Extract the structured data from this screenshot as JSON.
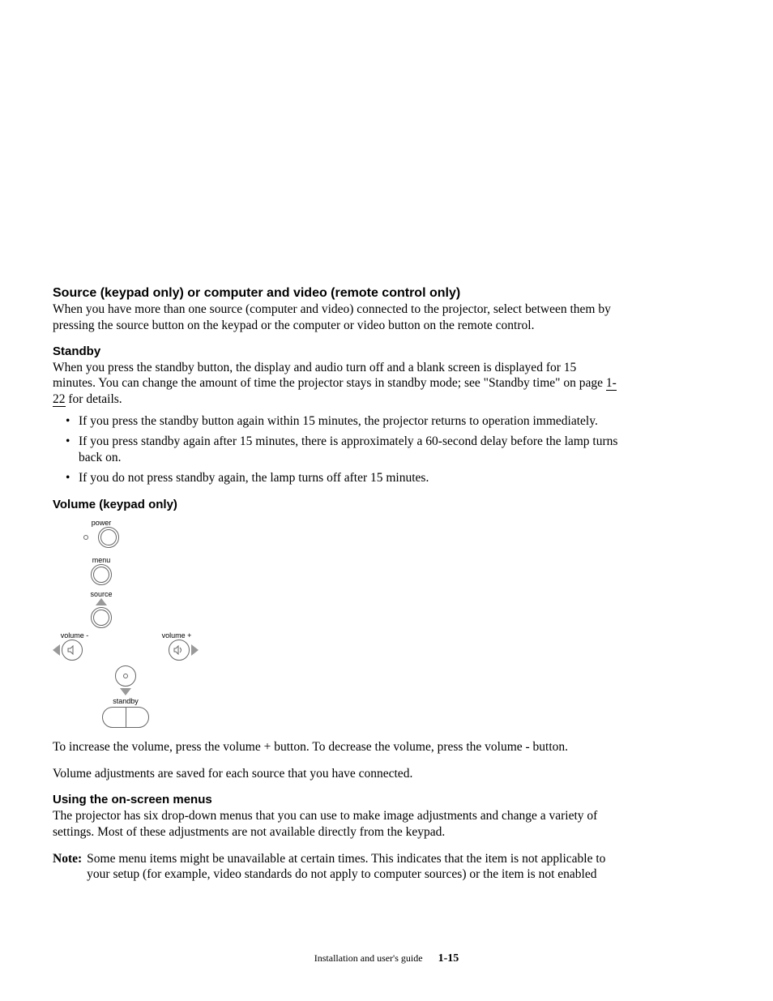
{
  "section1": {
    "heading": "Source (keypad only) or computer and video (remote control only)",
    "para": "When you have more than one source (computer and video) connected to the projector, select between them by pressing the source button on the keypad or the computer or video button on the remote control."
  },
  "section2": {
    "heading": "Standby",
    "para_a": "When you press the standby button, the display and audio turn off and a blank screen is displayed for 15 minutes. You can change the amount of time the projector stays in standby mode; see \"Standby time\" on page ",
    "link": "1-22",
    "para_b": " for details.",
    "bullets": [
      "If you press the standby button again within 15 minutes, the projector returns to operation immediately.",
      "If you press standby again after 15 minutes, there is approximately a 60-second delay before the lamp turns back on.",
      "If you do not press standby again, the lamp turns off after 15 minutes."
    ]
  },
  "section3": {
    "heading": "Volume (keypad only)",
    "keypad": {
      "power": "power",
      "menu": "menu",
      "source": "source",
      "volminus": "volume -",
      "volplus": "volume +",
      "standby": "standby"
    },
    "para1": "To increase the volume, press the volume + button. To decrease the volume, press the volume - button.",
    "para2": "Volume adjustments are saved for each source that you have connected."
  },
  "section4": {
    "heading": "Using the on-screen menus",
    "para": "The projector has six drop-down menus that you can use to make image adjustments and change a variety of settings. Most of these adjustments are not available directly from the keypad.",
    "note_label": "Note:",
    "note_body": "Some menu items might be unavailable at certain times. This indicates that the item is not applicable to your setup (for example, video standards do not apply to computer sources) or the item is not enabled"
  },
  "footer": {
    "text": "Installation and user's guide",
    "page": "1-15"
  }
}
